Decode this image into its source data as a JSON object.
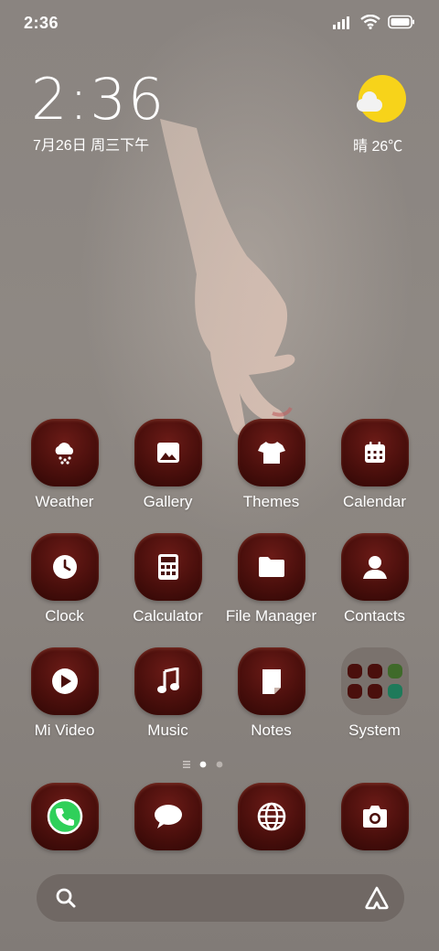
{
  "status_bar": {
    "time": "2:36"
  },
  "lock_clock": {
    "time": "2:36",
    "date": "7月26日 周三下午"
  },
  "weather_widget": {
    "text": "晴 26℃"
  },
  "apps": [
    {
      "label": "Weather",
      "icon": "cloud-snow-icon"
    },
    {
      "label": "Gallery",
      "icon": "image-icon"
    },
    {
      "label": "Themes",
      "icon": "tshirt-icon"
    },
    {
      "label": "Calendar",
      "icon": "calendar-icon"
    },
    {
      "label": "Clock",
      "icon": "clock-icon"
    },
    {
      "label": "Calculator",
      "icon": "calculator-icon"
    },
    {
      "label": "File Manager",
      "icon": "folder-icon"
    },
    {
      "label": "Contacts",
      "icon": "person-icon"
    },
    {
      "label": "Mi Video",
      "icon": "play-icon"
    },
    {
      "label": "Music",
      "icon": "music-note-icon"
    },
    {
      "label": "Notes",
      "icon": "note-icon"
    },
    {
      "label": "System",
      "icon": "folder-grid-icon"
    }
  ],
  "dock": [
    {
      "icon": "phone-icon"
    },
    {
      "icon": "message-icon"
    },
    {
      "icon": "browser-icon"
    },
    {
      "icon": "camera-icon"
    }
  ],
  "page_indicator": {
    "pages": 2,
    "current": 1
  },
  "colors": {
    "tile": "#4a0f0c",
    "sun": "#f7d31a",
    "phone_green": "#2fd05a"
  }
}
